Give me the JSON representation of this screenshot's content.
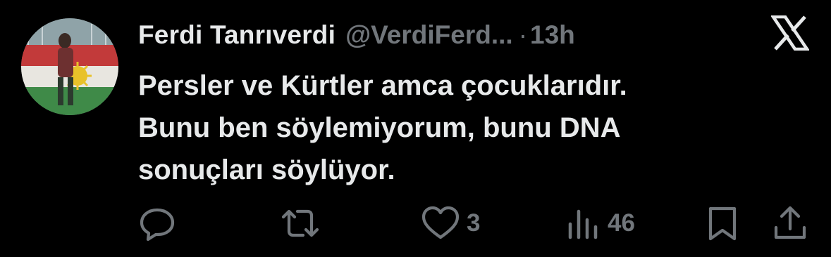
{
  "tweet": {
    "author": {
      "display_name": "Ferdi Tanrıverdi",
      "handle": "@VerdiFerd...",
      "separator": "·",
      "time": "13h"
    },
    "text_lines": [
      "Persler ve Kürtler amca çocuklarıdır.",
      "Bunu ben söylemiyorum, bunu DNA",
      "sonuçları söylüyor."
    ],
    "metrics": {
      "likes": "3",
      "views": "46"
    }
  },
  "icons": {
    "close": "x-logo-icon",
    "reply": "reply-icon",
    "repost": "repost-icon",
    "like": "heart-icon",
    "views": "views-icon",
    "bookmark": "bookmark-icon",
    "share": "share-icon"
  },
  "colors": {
    "background": "#000000",
    "primary_text": "#e7e9ea",
    "secondary_text": "#71767b"
  }
}
